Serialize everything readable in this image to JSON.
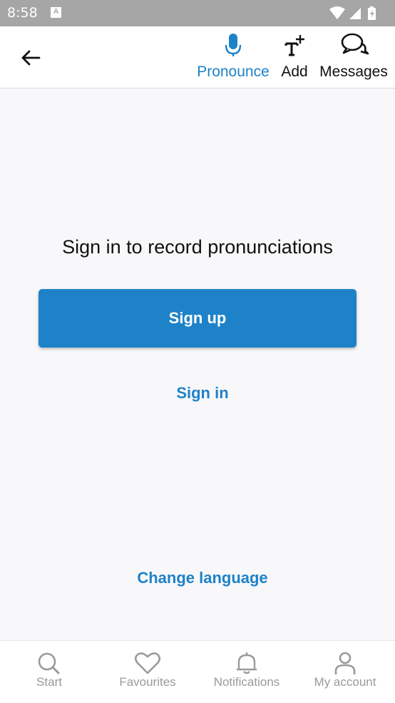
{
  "status_bar": {
    "time": "8:58"
  },
  "top_bar": {
    "tabs": [
      {
        "label": "Pronounce",
        "icon": "microphone-icon",
        "active": true
      },
      {
        "label": "Add",
        "icon": "add-text-icon",
        "active": false
      },
      {
        "label": "Messages",
        "icon": "chat-bubbles-icon",
        "active": false
      }
    ]
  },
  "main": {
    "prompt": "Sign in to record pronunciations",
    "signup_label": "Sign up",
    "signin_label": "Sign in",
    "change_language_label": "Change language"
  },
  "bottom_nav": {
    "items": [
      {
        "label": "Start",
        "icon": "search-icon"
      },
      {
        "label": "Favourites",
        "icon": "heart-icon"
      },
      {
        "label": "Notifications",
        "icon": "bell-icon"
      },
      {
        "label": "My account",
        "icon": "user-icon"
      }
    ]
  },
  "colors": {
    "accent": "#1e82c8",
    "status_bar": "#a6a6a6",
    "nav_inactive": "#9a9a9a",
    "background": "#f8f8fa"
  }
}
